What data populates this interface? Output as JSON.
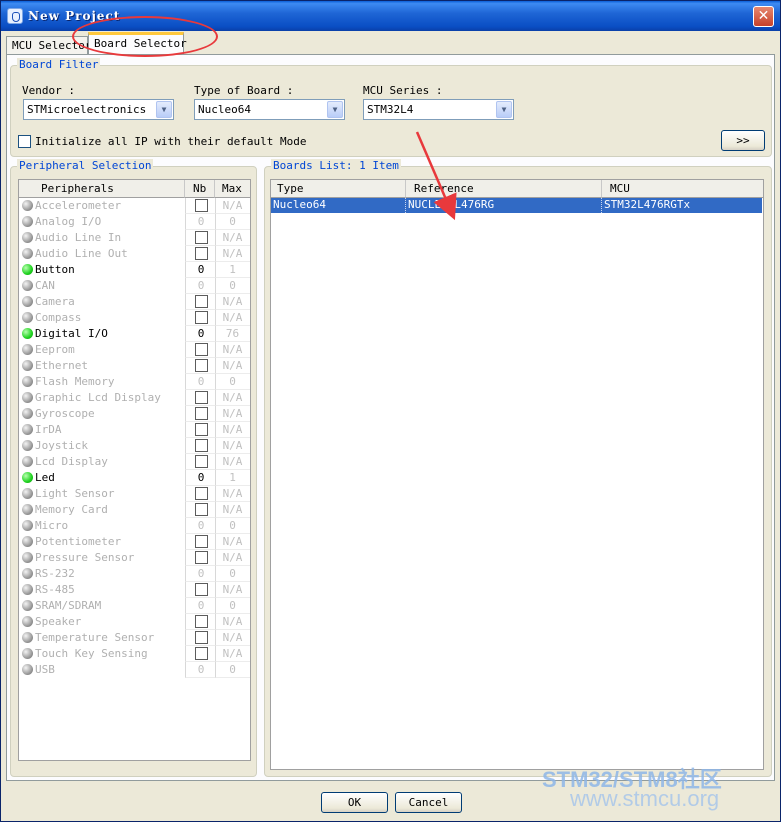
{
  "window": {
    "title": "New Project",
    "close_glyph": "✕"
  },
  "tabs": [
    {
      "label": "MCU Selector",
      "active": false
    },
    {
      "label": "Board Selector",
      "active": true
    }
  ],
  "board_filter": {
    "title": "Board Filter",
    "vendor_label": "Vendor :",
    "vendor_value": "STMicroelectronics",
    "board_type_label": "Type of Board :",
    "board_type_value": "Nucleo64",
    "mcu_series_label": "MCU Series :",
    "mcu_series_value": "STM32L4",
    "init_ip_label": "Initialize all IP with their default Mode",
    "expand_button": ">>"
  },
  "peripheral_selection": {
    "title": "Peripheral Selection",
    "columns": [
      "Peripherals",
      "Nb",
      "Max"
    ],
    "rows": [
      {
        "name": "Accelerometer",
        "enabled": false,
        "nb_box": true,
        "nb": "",
        "max": "N/A"
      },
      {
        "name": "Analog I/O",
        "enabled": false,
        "nb_box": false,
        "nb": "0",
        "max": "0"
      },
      {
        "name": "Audio Line In",
        "enabled": false,
        "nb_box": true,
        "nb": "",
        "max": "N/A"
      },
      {
        "name": "Audio Line Out",
        "enabled": false,
        "nb_box": true,
        "nb": "",
        "max": "N/A"
      },
      {
        "name": "Button",
        "enabled": true,
        "nb_box": false,
        "nb": "0",
        "max": "1"
      },
      {
        "name": "CAN",
        "enabled": false,
        "nb_box": false,
        "nb": "0",
        "max": "0"
      },
      {
        "name": "Camera",
        "enabled": false,
        "nb_box": true,
        "nb": "",
        "max": "N/A"
      },
      {
        "name": "Compass",
        "enabled": false,
        "nb_box": true,
        "nb": "",
        "max": "N/A"
      },
      {
        "name": "Digital I/O",
        "enabled": true,
        "nb_box": false,
        "nb": "0",
        "max": "76"
      },
      {
        "name": "Eeprom",
        "enabled": false,
        "nb_box": true,
        "nb": "",
        "max": "N/A"
      },
      {
        "name": "Ethernet",
        "enabled": false,
        "nb_box": true,
        "nb": "",
        "max": "N/A"
      },
      {
        "name": "Flash Memory",
        "enabled": false,
        "nb_box": false,
        "nb": "0",
        "max": "0"
      },
      {
        "name": "Graphic Lcd Display",
        "enabled": false,
        "nb_box": true,
        "nb": "",
        "max": "N/A"
      },
      {
        "name": "Gyroscope",
        "enabled": false,
        "nb_box": true,
        "nb": "",
        "max": "N/A"
      },
      {
        "name": "IrDA",
        "enabled": false,
        "nb_box": true,
        "nb": "",
        "max": "N/A"
      },
      {
        "name": "Joystick",
        "enabled": false,
        "nb_box": true,
        "nb": "",
        "max": "N/A"
      },
      {
        "name": "Lcd Display",
        "enabled": false,
        "nb_box": true,
        "nb": "",
        "max": "N/A"
      },
      {
        "name": "Led",
        "enabled": true,
        "nb_box": false,
        "nb": "0",
        "max": "1"
      },
      {
        "name": "Light Sensor",
        "enabled": false,
        "nb_box": true,
        "nb": "",
        "max": "N/A"
      },
      {
        "name": "Memory Card",
        "enabled": false,
        "nb_box": true,
        "nb": "",
        "max": "N/A"
      },
      {
        "name": "Micro",
        "enabled": false,
        "nb_box": false,
        "nb": "0",
        "max": "0"
      },
      {
        "name": "Potentiometer",
        "enabled": false,
        "nb_box": true,
        "nb": "",
        "max": "N/A"
      },
      {
        "name": "Pressure Sensor",
        "enabled": false,
        "nb_box": true,
        "nb": "",
        "max": "N/A"
      },
      {
        "name": "RS-232",
        "enabled": false,
        "nb_box": false,
        "nb": "0",
        "max": "0"
      },
      {
        "name": "RS-485",
        "enabled": false,
        "nb_box": true,
        "nb": "",
        "max": "N/A"
      },
      {
        "name": "SRAM/SDRAM",
        "enabled": false,
        "nb_box": false,
        "nb": "0",
        "max": "0"
      },
      {
        "name": "Speaker",
        "enabled": false,
        "nb_box": true,
        "nb": "",
        "max": "N/A"
      },
      {
        "name": "Temperature Sensor",
        "enabled": false,
        "nb_box": true,
        "nb": "",
        "max": "N/A"
      },
      {
        "name": "Touch Key Sensing",
        "enabled": false,
        "nb_box": true,
        "nb": "",
        "max": "N/A"
      },
      {
        "name": "USB",
        "enabled": false,
        "nb_box": false,
        "nb": "0",
        "max": "0"
      }
    ]
  },
  "boards_list": {
    "title": "Boards List: 1 Item",
    "columns": [
      "Type",
      "Reference",
      "MCU"
    ],
    "rows": [
      {
        "type": "Nucleo64",
        "reference": "NUCLEO-L476RG",
        "mcu": "STM32L476RGTx",
        "selected": true
      }
    ]
  },
  "footer": {
    "ok_label": "OK",
    "cancel_label": "Cancel"
  },
  "watermark": {
    "brand": "STM32/STM8社区",
    "url": "www.stmcu.org"
  },
  "colors": {
    "title_bar": "#0a4ec4",
    "group_title": "#0046d5",
    "selection": "#316ac5",
    "annotation": "#e8393c",
    "led_on": "#1fd21f"
  },
  "icons": {
    "window_icon": "cube-icon",
    "close": "close-icon",
    "dropdown": "chevron-down-icon",
    "status_led": "led-icon"
  }
}
